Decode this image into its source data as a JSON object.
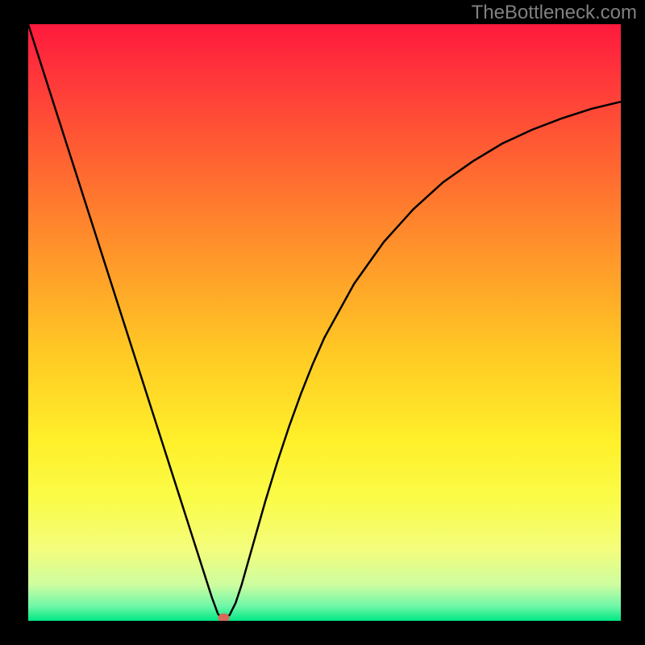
{
  "watermark": "TheBottleneck.com",
  "chart_data": {
    "type": "line",
    "title": "",
    "xlabel": "",
    "ylabel": "",
    "xlim": [
      0,
      100
    ],
    "ylim": [
      0,
      100
    ],
    "series": [
      {
        "name": "curve",
        "x": [
          0.0,
          2.0,
          4.0,
          6.0,
          8.0,
          10.0,
          12.0,
          14.0,
          16.0,
          18.0,
          20.0,
          22.0,
          24.0,
          26.0,
          28.0,
          30.0,
          31.0,
          32.0,
          32.5,
          33.0,
          33.5,
          34.0,
          35.0,
          36.0,
          37.0,
          38.0,
          39.0,
          40.0,
          42.0,
          44.0,
          46.0,
          48.0,
          50.0,
          55.0,
          60.0,
          65.0,
          70.0,
          75.0,
          80.0,
          85.0,
          90.0,
          95.0,
          100.0
        ],
        "y": [
          100.0,
          93.8,
          87.6,
          81.4,
          75.2,
          69.0,
          62.8,
          56.6,
          50.4,
          44.2,
          38.0,
          31.8,
          25.6,
          19.4,
          13.2,
          7.0,
          3.9,
          1.2,
          0.6,
          0.5,
          0.6,
          1.0,
          3.0,
          6.0,
          9.5,
          13.0,
          16.5,
          20.0,
          26.5,
          32.5,
          38.0,
          43.0,
          47.5,
          56.5,
          63.5,
          69.0,
          73.5,
          77.0,
          80.0,
          82.3,
          84.2,
          85.8,
          87.0
        ]
      }
    ],
    "marker": {
      "x": 33.0,
      "y": 0.5
    },
    "gradient_stops": [
      {
        "offset": 0.0,
        "color": "#ff1a3d"
      },
      {
        "offset": 0.1,
        "color": "#ff3a3a"
      },
      {
        "offset": 0.25,
        "color": "#ff6a30"
      },
      {
        "offset": 0.4,
        "color": "#ff9a2a"
      },
      {
        "offset": 0.55,
        "color": "#ffc924"
      },
      {
        "offset": 0.7,
        "color": "#fff02a"
      },
      {
        "offset": 0.8,
        "color": "#fafc4a"
      },
      {
        "offset": 0.88,
        "color": "#f4fd7c"
      },
      {
        "offset": 0.94,
        "color": "#cdfda0"
      },
      {
        "offset": 0.975,
        "color": "#70f7a8"
      },
      {
        "offset": 1.0,
        "color": "#00e884"
      }
    ]
  }
}
